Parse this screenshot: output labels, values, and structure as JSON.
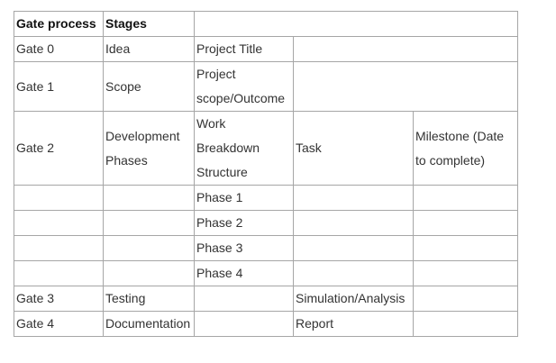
{
  "table": {
    "rows": [
      [
        {
          "text": "Gate process",
          "header": true
        },
        {
          "text": "Stages",
          "header": true
        },
        {
          "text": "",
          "colspan": 3
        }
      ],
      [
        {
          "text": "Gate 0"
        },
        {
          "text": "Idea"
        },
        {
          "text": "Project Title"
        },
        {
          "text": "",
          "colspan": 2
        }
      ],
      [
        {
          "text": "Gate 1"
        },
        {
          "text": "Scope"
        },
        {
          "text": "Project scope/Outcome"
        },
        {
          "text": "",
          "colspan": 2
        }
      ],
      [
        {
          "text": "Gate 2"
        },
        {
          "text": "Development Phases"
        },
        {
          "text": "Work Breakdown Structure"
        },
        {
          "text": "Task"
        },
        {
          "text": "Milestone (Date to complete)"
        }
      ],
      [
        {
          "text": ""
        },
        {
          "text": ""
        },
        {
          "text": "Phase 1"
        },
        {
          "text": ""
        },
        {
          "text": ""
        }
      ],
      [
        {
          "text": ""
        },
        {
          "text": ""
        },
        {
          "text": "Phase 2"
        },
        {
          "text": ""
        },
        {
          "text": ""
        }
      ],
      [
        {
          "text": ""
        },
        {
          "text": ""
        },
        {
          "text": "Phase 3"
        },
        {
          "text": ""
        },
        {
          "text": ""
        }
      ],
      [
        {
          "text": ""
        },
        {
          "text": ""
        },
        {
          "text": "Phase 4"
        },
        {
          "text": ""
        },
        {
          "text": ""
        }
      ],
      [
        {
          "text": "Gate 3"
        },
        {
          "text": "Testing"
        },
        {
          "text": ""
        },
        {
          "text": "Simulation/Analysis"
        },
        {
          "text": ""
        }
      ],
      [
        {
          "text": "Gate 4"
        },
        {
          "text": "Documentation"
        },
        {
          "text": ""
        },
        {
          "text": "Report"
        },
        {
          "text": ""
        }
      ]
    ]
  }
}
